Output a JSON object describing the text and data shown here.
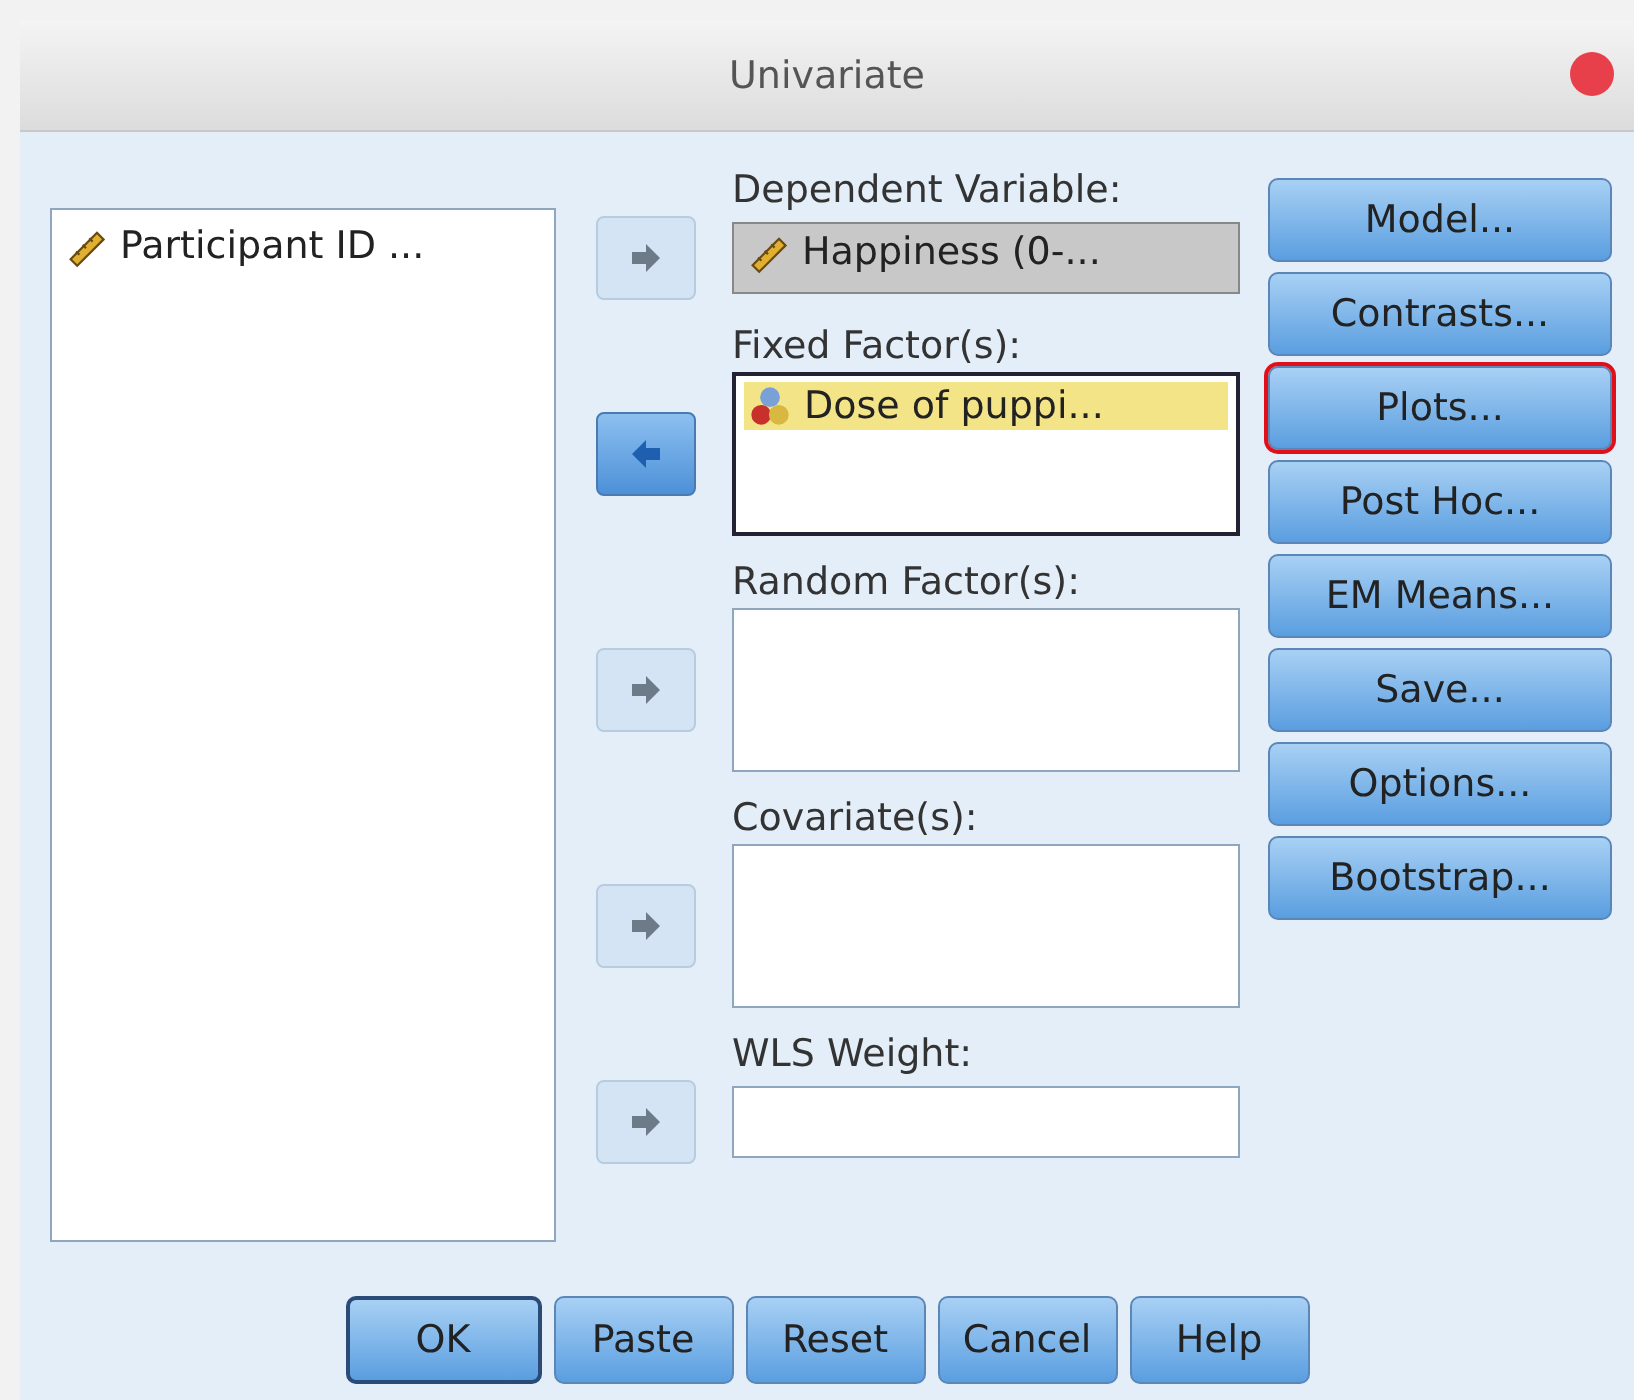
{
  "window": {
    "title": "Univariate"
  },
  "source_list": {
    "items": [
      {
        "label": "Participant ID ...",
        "kind": "scale",
        "selected": false
      }
    ]
  },
  "targets": [
    {
      "label": "Dependent Variable:",
      "kind": "single",
      "arrow": {
        "kind": "add",
        "enabled": false
      },
      "items": [
        {
          "label": "Happiness (0-...",
          "kind": "scale",
          "selected": false
        }
      ]
    },
    {
      "label": "Fixed Factor(s):",
      "kind": "list",
      "arrow": {
        "kind": "remove",
        "enabled": true
      },
      "items": [
        {
          "label": "Dose of puppi...",
          "kind": "nominal",
          "selected": true
        }
      ]
    },
    {
      "label": "Random Factor(s):",
      "kind": "list",
      "arrow": {
        "kind": "add",
        "enabled": false
      }
    },
    {
      "label": "Covariate(s):",
      "kind": "list",
      "arrow": {
        "kind": "add",
        "enabled": false
      }
    },
    {
      "label": "WLS Weight:",
      "kind": "single",
      "arrow": {
        "kind": "add",
        "enabled": false
      }
    }
  ],
  "side_buttons": [
    {
      "label": "Model...",
      "highlighted": false
    },
    {
      "label": "Contrasts...",
      "highlighted": false
    },
    {
      "label": "Plots...",
      "highlighted": true
    },
    {
      "label": "Post Hoc...",
      "highlighted": false
    },
    {
      "label": "EM Means...",
      "highlighted": false
    },
    {
      "label": "Save...",
      "highlighted": false
    },
    {
      "label": "Options...",
      "highlighted": false
    },
    {
      "label": "Bootstrap...",
      "highlighted": false
    }
  ],
  "bottom_buttons": [
    {
      "label": "OK",
      "default": true
    },
    {
      "label": "Paste",
      "default": false
    },
    {
      "label": "Reset",
      "default": false
    },
    {
      "label": "Cancel",
      "default": false
    },
    {
      "label": "Help",
      "default": false
    }
  ]
}
